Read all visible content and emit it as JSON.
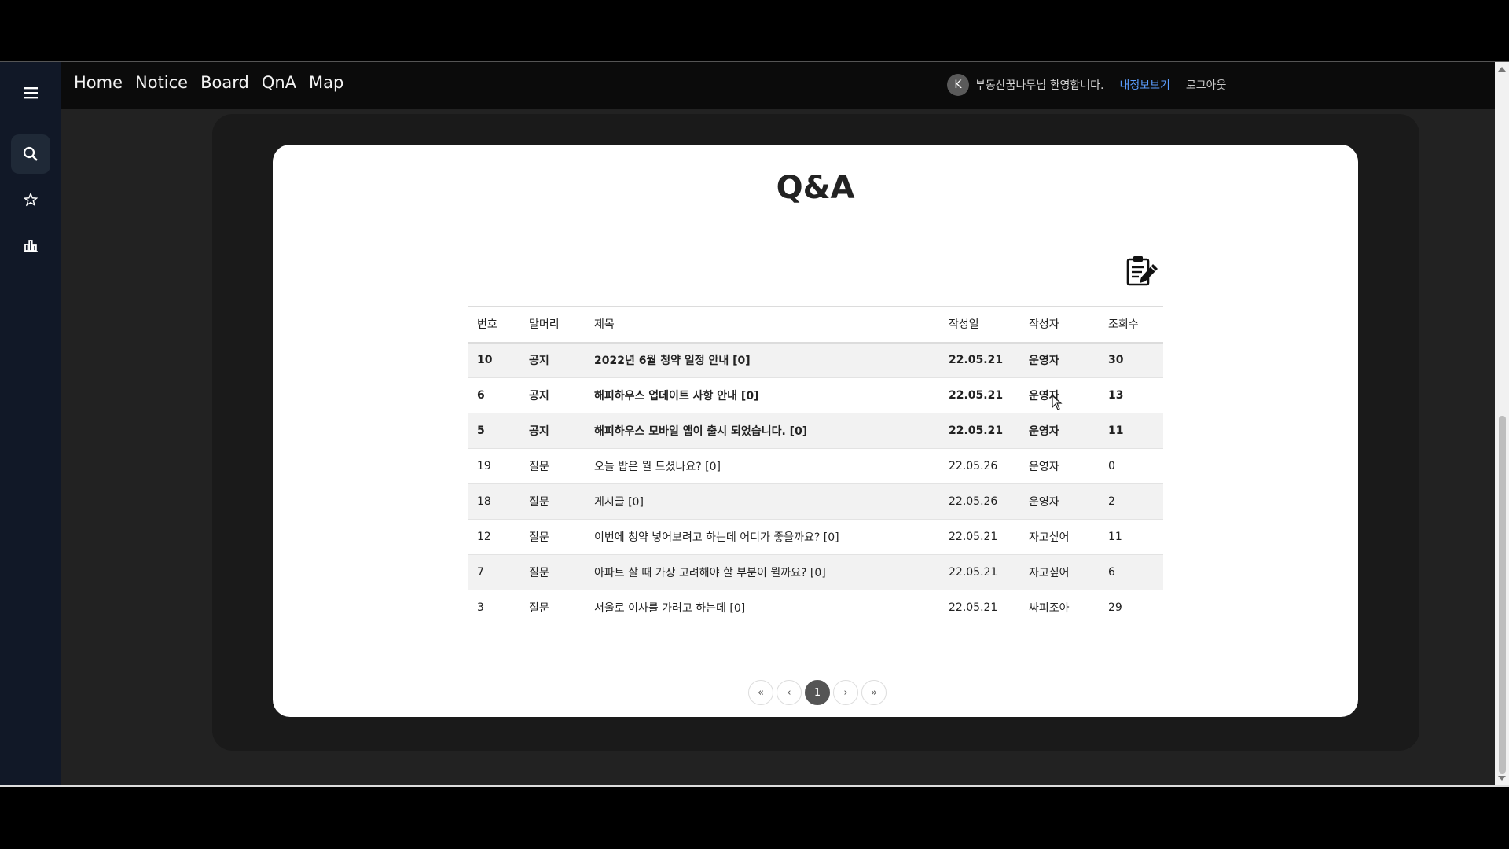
{
  "nav": {
    "items": [
      "Home",
      "Notice",
      "Board",
      "QnA",
      "Map"
    ]
  },
  "user": {
    "avatar_letter": "K",
    "welcome": "부동산꿈나무님 환영합니다.",
    "myinfo": "내정보보기",
    "logout": "로그아웃"
  },
  "sidebar": {
    "icons": [
      "menu-icon",
      "search-icon",
      "star-icon",
      "chart-icon"
    ]
  },
  "page": {
    "title": "Q&A"
  },
  "table": {
    "headers": [
      "번호",
      "말머리",
      "제목",
      "작성일",
      "작성자",
      "조회수"
    ],
    "rows": [
      {
        "no": "10",
        "tag": "공지",
        "title": "2022년 6월 청약 일정 안내 [0]",
        "date": "22.05.21",
        "author": "운영자",
        "views": "30",
        "notice": true
      },
      {
        "no": "6",
        "tag": "공지",
        "title": "해피하우스 업데이트 사항 안내 [0]",
        "date": "22.05.21",
        "author": "운영자",
        "views": "13",
        "notice": true
      },
      {
        "no": "5",
        "tag": "공지",
        "title": "해피하우스 모바일 앱이 출시 되었습니다. [0]",
        "date": "22.05.21",
        "author": "운영자",
        "views": "11",
        "notice": true
      },
      {
        "no": "19",
        "tag": "질문",
        "title": "오늘 밥은 뭘 드셨나요? [0]",
        "date": "22.05.26",
        "author": "운영자",
        "views": "0",
        "notice": false
      },
      {
        "no": "18",
        "tag": "질문",
        "title": "게시글 [0]",
        "date": "22.05.26",
        "author": "운영자",
        "views": "2",
        "notice": false
      },
      {
        "no": "12",
        "tag": "질문",
        "title": "이번에 청약 넣어보려고 하는데 어디가 좋을까요? [0]",
        "date": "22.05.21",
        "author": "자고싶어",
        "views": "11",
        "notice": false
      },
      {
        "no": "7",
        "tag": "질문",
        "title": "아파트 살 때 가장 고려해야 할 부분이 뭘까요? [0]",
        "date": "22.05.21",
        "author": "자고싶어",
        "views": "6",
        "notice": false
      },
      {
        "no": "3",
        "tag": "질문",
        "title": "서울로 이사를 가려고 하는데 [0]",
        "date": "22.05.21",
        "author": "싸피조아",
        "views": "29",
        "notice": false
      }
    ]
  },
  "pagination": {
    "first": "«",
    "prev": "‹",
    "current": "1",
    "next": "›",
    "last": "»"
  }
}
